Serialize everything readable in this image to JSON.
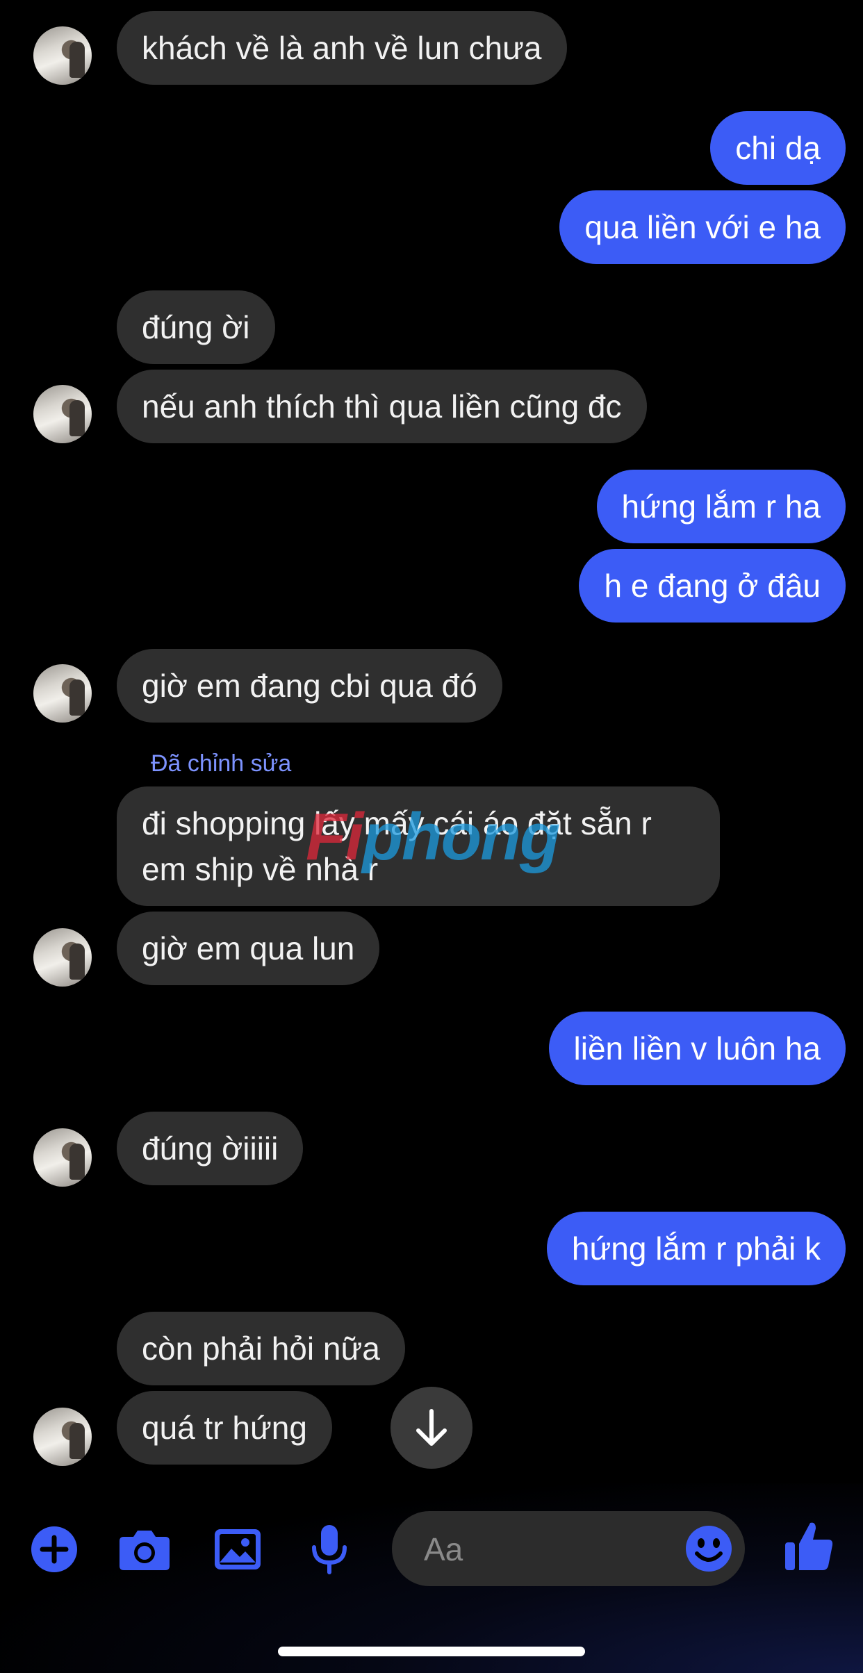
{
  "messages": {
    "m1": "khách về là anh về lun chưa",
    "m2": "chi dạ",
    "m3": "qua liền với e ha",
    "m4": "đúng ời",
    "m5": "nếu anh thích thì qua liền cũng đc",
    "m6": "hứng lắm r ha",
    "m7": "h e đang ở đâu",
    "m8": "giờ em đang cbi qua đó",
    "m9_edited_label": "Đã chỉnh sửa",
    "m9": "đi shopping lấy mấy cái áo đặt sẵn r em ship về nhà r",
    "m10": "giờ em qua lun",
    "m11": "liền liền v luôn ha",
    "m12": "đúng ờiiiii",
    "m13": "hứng lắm r phải k",
    "m14": "còn phải hỏi nữa",
    "m15": "quá tr hứng"
  },
  "watermark": {
    "part1": "Fi",
    "part2": "phong"
  },
  "composer": {
    "placeholder": "Aa"
  },
  "icons": {
    "add": "plus-circle-icon",
    "camera": "camera-icon",
    "gallery": "image-icon",
    "mic": "microphone-icon",
    "emoji": "smiley-icon",
    "like": "thumbs-up-icon",
    "scroll": "arrow-down-icon"
  },
  "colors": {
    "outgoing_bubble": "#3c5cf6",
    "incoming_bubble": "#2f2f2f",
    "accent": "#3c5cf6",
    "edited_label": "#7d93ff"
  }
}
